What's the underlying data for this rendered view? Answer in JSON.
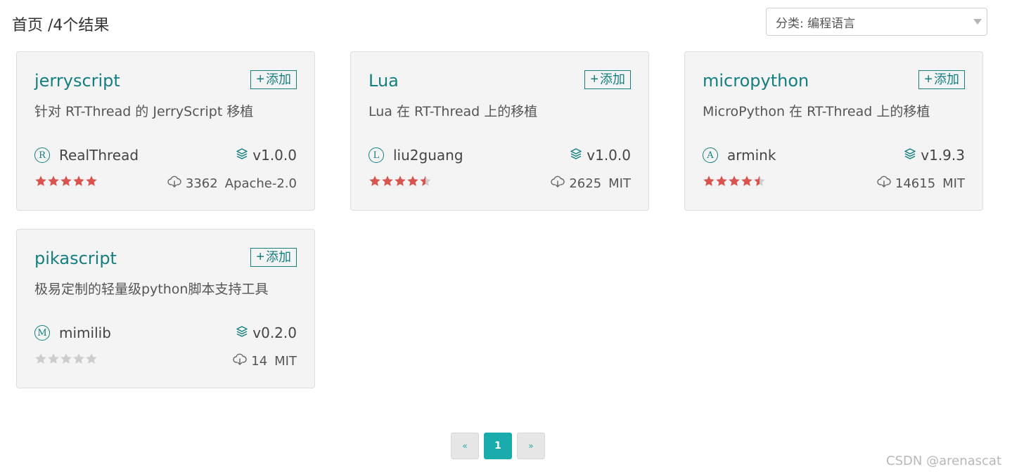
{
  "breadcrumb": {
    "text": "首页 /4个结果"
  },
  "category_select": {
    "value": "分类: 编程语言"
  },
  "add_label": "添加",
  "cards": [
    {
      "name": "jerryscript",
      "description": "针对 RT-Thread 的 JerryScript 移植",
      "author_initial": "R",
      "author": "RealThread",
      "version": "v1.0.0",
      "rating": 5,
      "downloads": "3362",
      "license": "Apache-2.0"
    },
    {
      "name": "Lua",
      "description": "Lua 在 RT-Thread 上的移植",
      "author_initial": "L",
      "author": "liu2guang",
      "version": "v1.0.0",
      "rating": 4.5,
      "downloads": "2625",
      "license": "MIT"
    },
    {
      "name": "micropython",
      "description": "MicroPython 在 RT-Thread 上的移植",
      "author_initial": "A",
      "author": "armink",
      "version": "v1.9.3",
      "rating": 4.5,
      "downloads": "14615",
      "license": "MIT"
    },
    {
      "name": "pikascript",
      "description": "极易定制的轻量级python脚本支持工具",
      "author_initial": "M",
      "author": "mimilib",
      "version": "v0.2.0",
      "rating": 0,
      "downloads": "14",
      "license": "MIT"
    }
  ],
  "pagination": {
    "prev": "«",
    "current": "1",
    "next": "»"
  },
  "watermark": "CSDN @arenascat",
  "colors": {
    "accent": "#157f80",
    "star_filled": "#d9534f",
    "star_empty": "#cccccc",
    "page_active": "#1aabad"
  },
  "icons": {
    "version": "layers-icon",
    "downloads": "cloud-download-icon",
    "stars": "star-icon"
  }
}
